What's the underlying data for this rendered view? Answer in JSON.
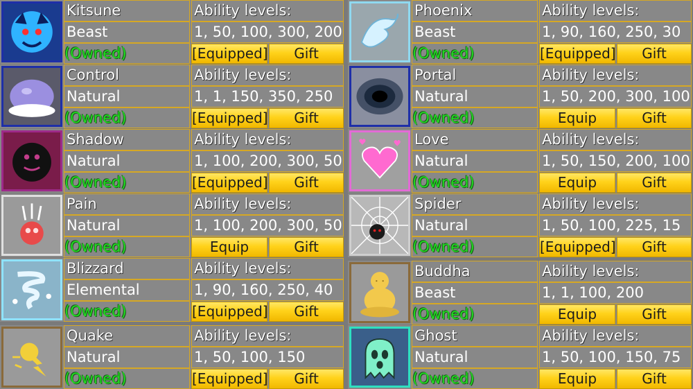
{
  "labels": {
    "ability_levels": "Ability levels:",
    "owned": "(Owned)"
  },
  "fruits": [
    {
      "name": "Kitsune",
      "type": "Beast",
      "levels": "1, 50, 100, 300, 200",
      "equip_label": "[Equipped]",
      "gift_label": "Gift",
      "icon": "kitsune-icon"
    },
    {
      "name": "Phoenix",
      "type": "Beast",
      "levels": "1, 90, 160, 250, 30",
      "equip_label": "[Equipped]",
      "gift_label": "Gift",
      "icon": "phoenix-icon"
    },
    {
      "name": "Control",
      "type": "Natural",
      "levels": "1, 1, 150, 350, 250",
      "equip_label": "[Equipped]",
      "gift_label": "Gift",
      "icon": "control-icon"
    },
    {
      "name": "Portal",
      "type": "Natural",
      "levels": "1, 50, 200, 300, 100",
      "equip_label": "Equip",
      "gift_label": "Gift",
      "icon": "portal-icon"
    },
    {
      "name": "Shadow",
      "type": "Natural",
      "levels": "1, 100, 200, 300, 50",
      "equip_label": "[Equipped]",
      "gift_label": "Gift",
      "icon": "shadow-icon"
    },
    {
      "name": "Love",
      "type": "Natural",
      "levels": "1, 50, 150, 200, 100",
      "equip_label": "Equip",
      "gift_label": "Gift",
      "icon": "love-icon"
    },
    {
      "name": "Pain",
      "type": "Natural",
      "levels": "1, 100, 200, 300, 50",
      "equip_label": "Equip",
      "gift_label": "Gift",
      "icon": "pain-icon"
    },
    {
      "name": "Spider",
      "type": "Natural",
      "levels": "1, 50, 100, 225, 15",
      "equip_label": "[Equipped]",
      "gift_label": "Gift",
      "icon": "spider-icon"
    },
    {
      "name": "Blizzard",
      "type": "Elemental",
      "levels": "1, 90, 160, 250, 40",
      "equip_label": "[Equipped]",
      "gift_label": "Gift",
      "icon": "blizzard-icon"
    },
    {
      "name": "Buddha",
      "type": "Beast",
      "levels": "1, 1, 100, 200",
      "equip_label": "Equip",
      "gift_label": "Gift",
      "icon": "buddha-icon"
    },
    {
      "name": "Quake",
      "type": "Natural",
      "levels": "1, 50, 100, 150",
      "equip_label": "[Equipped]",
      "gift_label": "Gift",
      "icon": "quake-icon"
    },
    {
      "name": "Ghost",
      "type": "Natural",
      "levels": "1, 50, 100, 150, 75",
      "equip_label": "Equip",
      "gift_label": "Gift",
      "icon": "ghost-icon"
    }
  ],
  "colors": {
    "owned_text": "#22dd22",
    "cell_border": "#d6a824",
    "button_gold": "#ffd21a",
    "panel_gray": "#888888"
  }
}
